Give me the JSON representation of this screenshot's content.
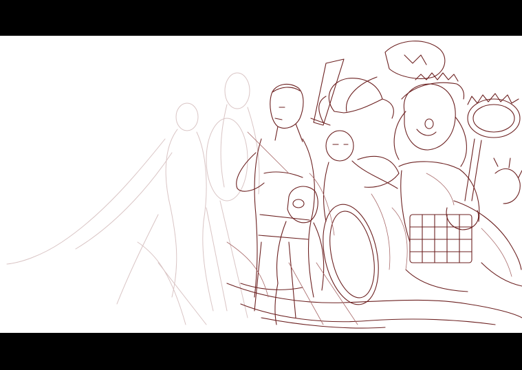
{
  "image": {
    "kind": "sketch",
    "colors": {
      "letterbox": "#000000",
      "paper": "#ffffff",
      "ink": "#6b1f1f",
      "ink_light": "#a86a6a",
      "ink_faint": "#d9c4c4"
    }
  }
}
